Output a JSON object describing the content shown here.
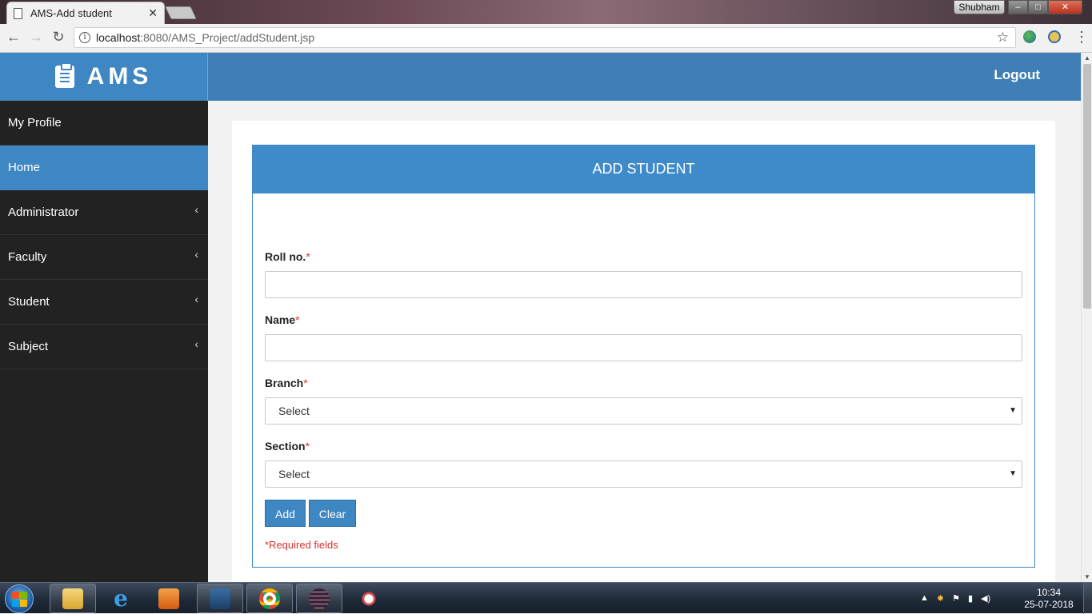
{
  "browser": {
    "tab_title": "AMS-Add student",
    "tab_close": "✕",
    "window_user": "Shubham",
    "url_host": "localhost",
    "url_path": ":8080/AMS_Project/addStudent.jsp",
    "back_glyph": "←",
    "forward_glyph": "→",
    "reload_glyph": "↻",
    "info_glyph": "i",
    "star_glyph": "☆",
    "menu_glyph": "⋮"
  },
  "app": {
    "brand_name": "AMS",
    "brand_icon": "clipboard-icon",
    "logout_label": "Logout"
  },
  "sidebar": {
    "items": [
      {
        "label": "My Profile",
        "has_submenu": false,
        "active": false
      },
      {
        "label": "Home",
        "has_submenu": false,
        "active": true
      },
      {
        "label": "Administrator",
        "has_submenu": true,
        "active": false
      },
      {
        "label": "Faculty",
        "has_submenu": true,
        "active": false
      },
      {
        "label": "Student",
        "has_submenu": true,
        "active": false
      },
      {
        "label": "Subject",
        "has_submenu": true,
        "active": false
      }
    ],
    "chevron_glyph": "‹"
  },
  "form": {
    "title": "ADD STUDENT",
    "roll_label": "Roll no.",
    "name_label": "Name",
    "branch_label": "Branch",
    "section_label": "Section",
    "required_mark": "*",
    "roll_value": "",
    "name_value": "",
    "branch_selected": "Select",
    "section_selected": "Select",
    "caret_glyph": "▼",
    "add_label": "Add",
    "clear_label": "Clear",
    "required_note": "*Required fields"
  },
  "taskbar": {
    "time": "10:34",
    "date": "25-07-2018",
    "tray_arrow": "▲"
  },
  "colors": {
    "brand_blue": "#3f87c3",
    "sidebar_dark": "#222222",
    "required_red": "#d9322b"
  }
}
